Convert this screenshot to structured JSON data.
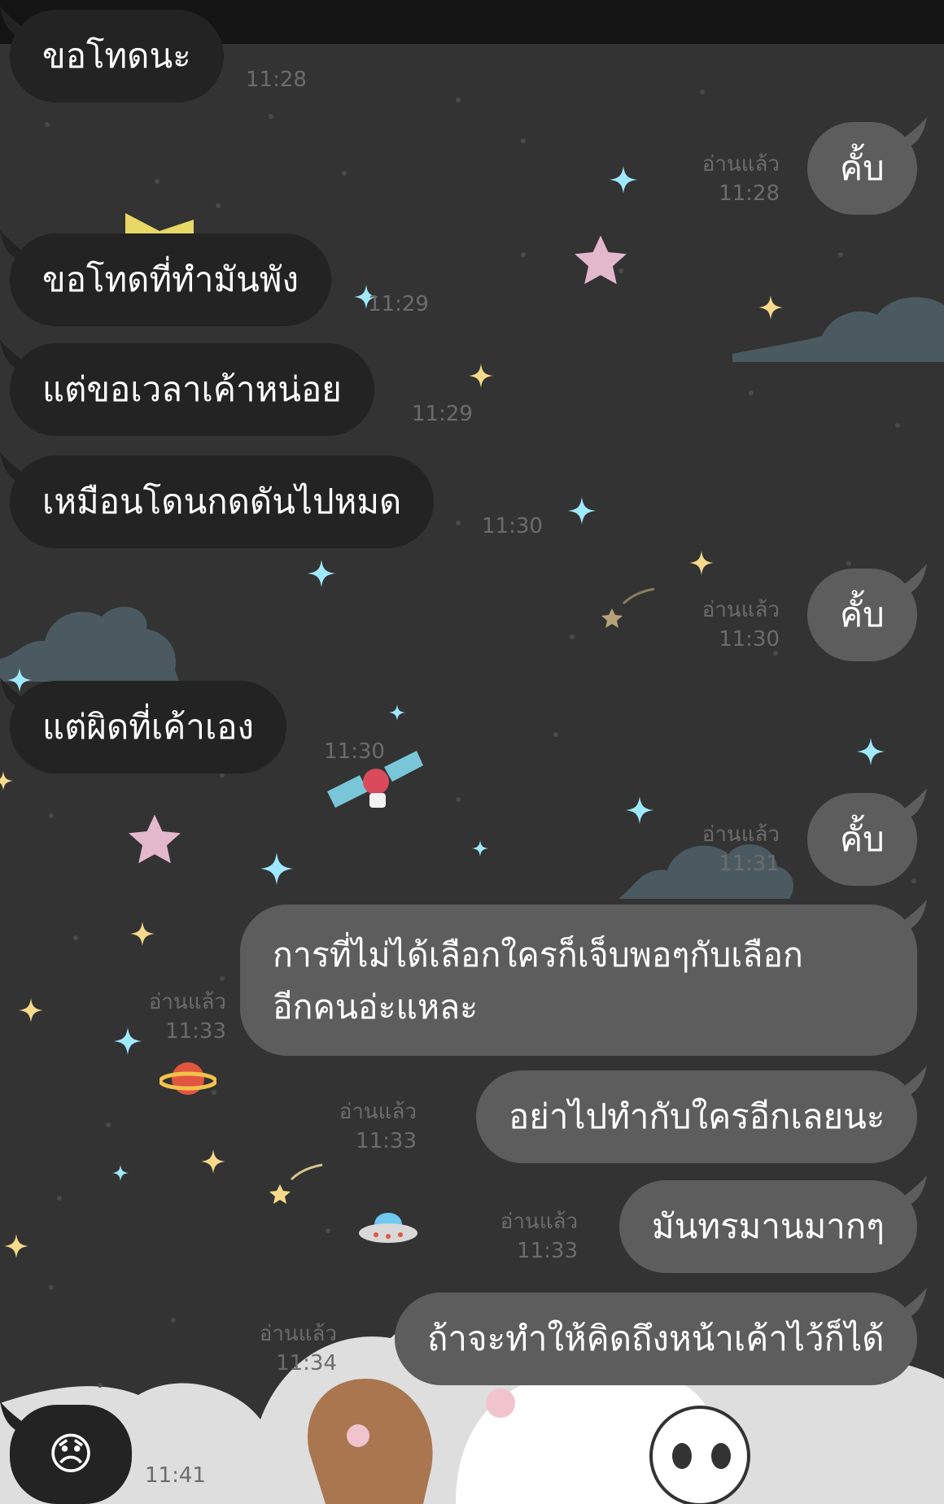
{
  "messages": [
    {
      "side": "in",
      "text": "ขอโทดนะ",
      "time": "11:28"
    },
    {
      "side": "out",
      "text": "คั้บ",
      "read": "อ่านแล้ว",
      "time": "11:28"
    },
    {
      "side": "in",
      "text": "ขอโทดที่ทำมันพัง",
      "time": "11:29"
    },
    {
      "side": "in",
      "text": "แต่ขอเวลาเค้าหน่อย",
      "time": "11:29"
    },
    {
      "side": "in",
      "text": "เหมือนโดนกดดันไปหมด",
      "time": "11:30"
    },
    {
      "side": "out",
      "text": "คั้บ",
      "read": "อ่านแล้ว",
      "time": "11:30"
    },
    {
      "side": "in",
      "text": "แต่ผิดที่เค้าเอง",
      "time": "11:30"
    },
    {
      "side": "out",
      "text": "คั้บ",
      "read": "อ่านแล้ว",
      "time": "11:31"
    },
    {
      "side": "out",
      "line1": "การที่ไม่ได้เลือกใครก็เจ็บพอๆกับเลือก",
      "line2": "อีกคนอ่ะแหละ",
      "read": "อ่านแล้ว",
      "time": "11:33"
    },
    {
      "side": "out",
      "text": "อย่าไปทำกับใครอีกเลยนะ",
      "read": "อ่านแล้ว",
      "time": "11:33"
    },
    {
      "side": "out",
      "text": "มันทรมานมากๆ",
      "read": "อ่านแล้ว",
      "time": "11:33"
    },
    {
      "side": "out",
      "text": "ถ้าจะทำให้คิดถึงหน้าเค้าไว้ก็ได้",
      "read": "อ่านแล้ว",
      "time": "11:34"
    },
    {
      "side": "in",
      "emoji": "😞",
      "time": "11:41"
    }
  ],
  "colors": {
    "background": "#333333",
    "incoming_bubble": "#232323",
    "outgoing_bubble": "#5d5d5d",
    "meta_text": "#6c6c6c",
    "sparkle_yellow": "#f6d98a",
    "sparkle_blue": "#9fe9ff",
    "star_pink": "#e4b8cc",
    "cloud": "#4b5a61"
  },
  "wallpaper": {
    "theme": "night-sky-sparkles-clouds-bears"
  }
}
